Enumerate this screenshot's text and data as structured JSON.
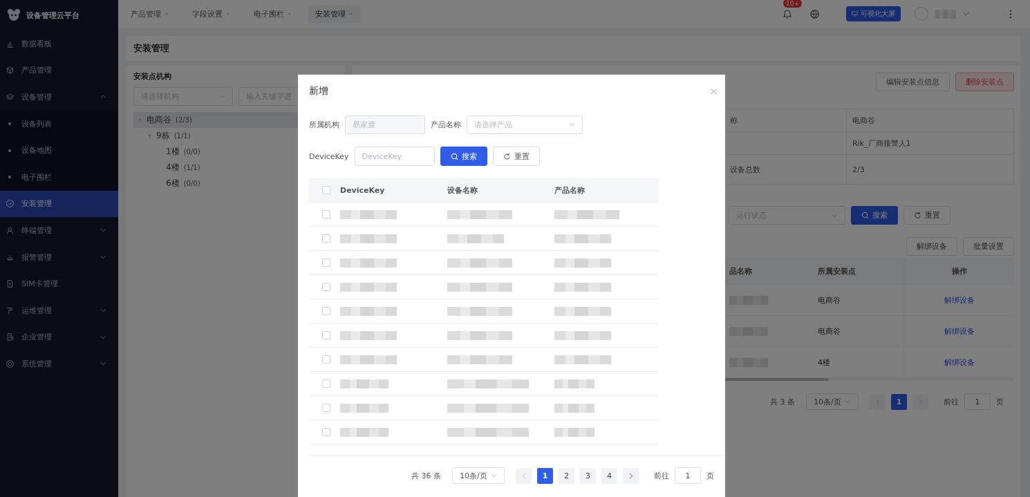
{
  "app": {
    "title": "设备管理云平台"
  },
  "sidebar": {
    "items": [
      {
        "label": "数据看板",
        "selected": false
      },
      {
        "label": "产品管理",
        "selected": false
      },
      {
        "label": "设备管理",
        "selected": false,
        "expanded": true,
        "children": [
          {
            "label": "设备列表",
            "selected": false
          },
          {
            "label": "设备地图",
            "selected": false
          },
          {
            "label": "电子围栏",
            "selected": false
          }
        ]
      },
      {
        "label": "安装管理",
        "selected": true
      },
      {
        "label": "终端管理",
        "selected": false,
        "expanded": false
      },
      {
        "label": "报警管理",
        "selected": false,
        "expanded": false
      },
      {
        "label": "SIM卡管理",
        "selected": false
      },
      {
        "label": "运维管理",
        "selected": false,
        "expanded": false
      },
      {
        "label": "企业管理",
        "selected": false,
        "expanded": false
      },
      {
        "label": "系统管理",
        "selected": false,
        "expanded": false
      }
    ]
  },
  "tabs": [
    {
      "label": "产品管理",
      "selected": false
    },
    {
      "label": "字段设置",
      "selected": false
    },
    {
      "label": "电子围栏",
      "selected": false
    },
    {
      "label": "安装管理",
      "selected": true
    }
  ],
  "header": {
    "notification_badge": "10+",
    "screen_button": "可视化大屏"
  },
  "page_title": "安装管理",
  "tree_panel": {
    "title": "安装点机构",
    "org_select": {
      "placeholder": "请选择机构"
    },
    "keyword_field": {
      "placeholder": "输入关键字进"
    },
    "tree": [
      {
        "label": "电商谷",
        "count": "(2/3)",
        "expanded": true,
        "selected": true,
        "children": [
          {
            "label": "9栋",
            "count": "(1/1)",
            "expanded": true,
            "selected": false,
            "children": [
              {
                "label": "1楼",
                "count": "(0/0)",
                "selected": false
              },
              {
                "label": "4楼",
                "count": "(1/1)",
                "selected": false
              },
              {
                "label": "6楼",
                "count": "(0/0)",
                "selected": false
              }
            ]
          }
        ]
      }
    ]
  },
  "detail_panel": {
    "buttons": [
      {
        "label": "编辑安装点信息",
        "kind": "default"
      },
      {
        "label": "删除安装点",
        "kind": "danger"
      }
    ],
    "info": [
      {
        "label": "称",
        "value": "电商谷"
      },
      {
        "value": "Rik_厂商接警人1"
      },
      {
        "label": "设备总数",
        "value": "2/3"
      }
    ],
    "status_select": {
      "placeholder": "运行状态"
    },
    "search_button": "搜索",
    "reset_button": "重置",
    "actions": [
      "解绑设备",
      "批量设置"
    ],
    "table": {
      "columns": [
        "品名称",
        "所属安装点",
        "操作"
      ],
      "rows": [
        {
          "location": "电商谷",
          "action": "解绑设备"
        },
        {
          "location": "电商谷",
          "action": "解绑设备"
        },
        {
          "location": "4楼",
          "action": "解绑设备"
        }
      ]
    },
    "pagination": {
      "total": "共 3 条",
      "page_size": "10条/页",
      "pages": [
        {
          "label": "1",
          "selected": true
        }
      ],
      "goto_label": "前往",
      "goto_value": "1",
      "goto_suffix": "页"
    }
  },
  "modal": {
    "title": "新增",
    "org_label": "所属机构",
    "org_value": "易家渡",
    "product_label": "产品名称",
    "product_select": {
      "placeholder": "请选择产品"
    },
    "key_label": "DeviceKey",
    "key_field": {
      "placeholder": "DeviceKey"
    },
    "search_button": "搜索",
    "reset_button": "重置",
    "table": {
      "columns": [
        "DeviceKey",
        "设备名称",
        "产品名称"
      ],
      "all_checked": false,
      "rows": [
        {
          "checked": false
        },
        {
          "checked": false
        },
        {
          "checked": false
        },
        {
          "checked": false
        },
        {
          "checked": false
        },
        {
          "checked": false
        },
        {
          "checked": false
        },
        {
          "checked": false
        },
        {
          "checked": false
        },
        {
          "checked": false
        }
      ]
    },
    "pagination": {
      "total": "共 36 条",
      "page_size": "10条/页",
      "pages": [
        {
          "label": "1",
          "selected": true
        },
        {
          "label": "2",
          "selected": false
        },
        {
          "label": "3",
          "selected": false
        },
        {
          "label": "4",
          "selected": false
        }
      ],
      "goto_label": "前往",
      "goto_value": "1",
      "goto_suffix": "页"
    }
  }
}
